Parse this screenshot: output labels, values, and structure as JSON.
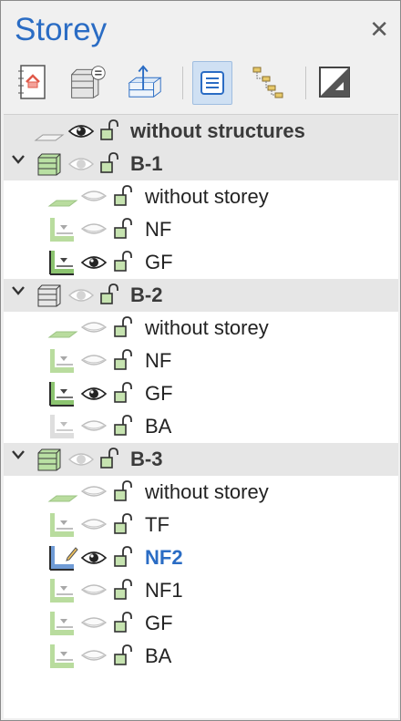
{
  "panel": {
    "title": "Storey",
    "close_glyph": "✕"
  },
  "toolbar": [
    {
      "name": "storey-settings-icon"
    },
    {
      "name": "storey-table-icon"
    },
    {
      "name": "storey-height-icon"
    },
    {
      "name": "list-view-icon",
      "active": true
    },
    {
      "name": "hierarchy-icon"
    },
    {
      "name": "contrast-icon"
    }
  ],
  "tree": [
    {
      "type": "group",
      "label": "without structures",
      "icon": "without-structure-icon",
      "eye": true,
      "chevron": false
    },
    {
      "type": "group",
      "label": "B-1",
      "icon": "building-green-icon",
      "eye": false,
      "chevron": true
    },
    {
      "type": "item",
      "label": "without storey",
      "icon": "without-storey-icon",
      "eye": false
    },
    {
      "type": "item",
      "label": "NF",
      "icon": "storey-icon",
      "eye": false
    },
    {
      "type": "item",
      "label": "GF",
      "icon": "storey-icon-dark",
      "eye": true
    },
    {
      "type": "group",
      "label": "B-2",
      "icon": "building-gray-icon",
      "eye": false,
      "chevron": true
    },
    {
      "type": "item",
      "label": "without storey",
      "icon": "without-storey-icon",
      "eye": false
    },
    {
      "type": "item",
      "label": "NF",
      "icon": "storey-icon",
      "eye": false
    },
    {
      "type": "item",
      "label": "GF",
      "icon": "storey-icon-dark",
      "eye": true
    },
    {
      "type": "item",
      "label": "BA",
      "icon": "storey-icon-gray",
      "eye": false
    },
    {
      "type": "group",
      "label": "B-3",
      "icon": "building-green-icon",
      "eye": false,
      "chevron": true
    },
    {
      "type": "item",
      "label": "without storey",
      "icon": "without-storey-icon",
      "eye": false
    },
    {
      "type": "item",
      "label": "TF",
      "icon": "storey-icon",
      "eye": false
    },
    {
      "type": "item",
      "label": "NF2",
      "icon": "storey-icon-active",
      "eye": true,
      "active": true
    },
    {
      "type": "item",
      "label": "NF1",
      "icon": "storey-icon",
      "eye": false
    },
    {
      "type": "item",
      "label": "GF",
      "icon": "storey-icon",
      "eye": false
    },
    {
      "type": "item",
      "label": "BA",
      "icon": "storey-icon",
      "eye": false
    }
  ]
}
